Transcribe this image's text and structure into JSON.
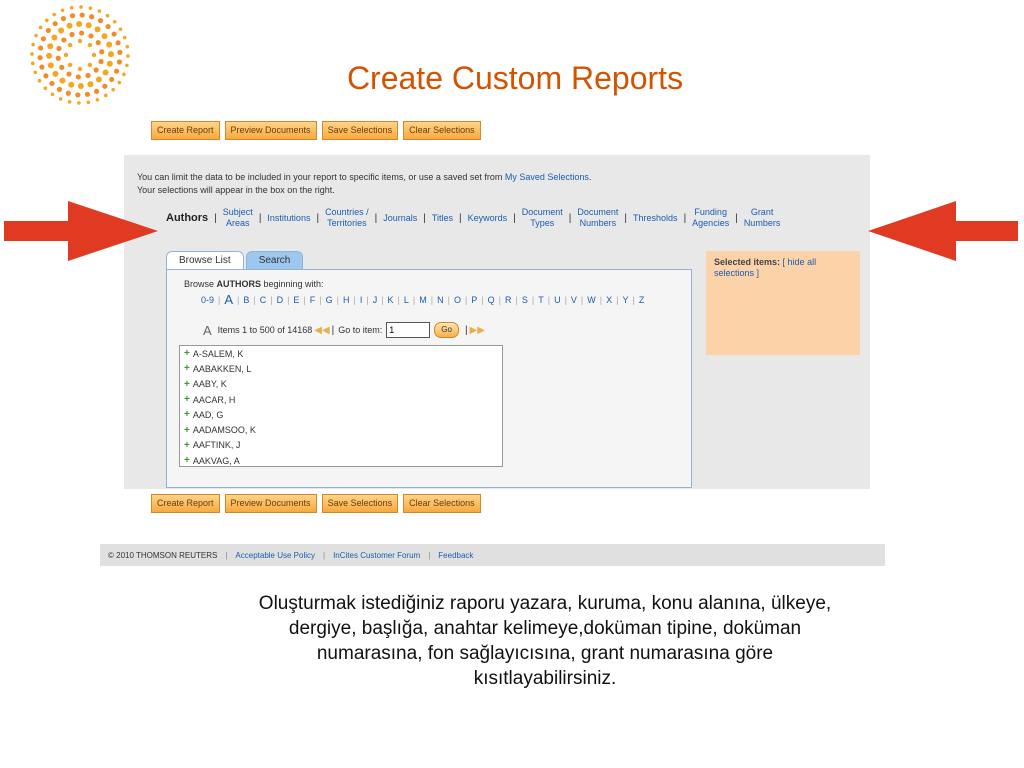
{
  "slide": {
    "title": "Create Custom Reports",
    "description": "Oluşturmak istediğiniz raporu yazara, kuruma, konu alanına, ülkeye, dergiye, başlığa, anahtar kelimeye,doküman tipine, doküman numarasına, fon sağlayıcısına, grant numarasına göre kısıtlayabilirsiniz."
  },
  "colors": {
    "accent": "#d35400",
    "button": "#f7a93f",
    "link": "#1a5db0",
    "selected_bg": "#fcd2a8",
    "arrow": "#e03a22"
  },
  "toolbar": {
    "create_report": "Create Report",
    "preview_documents": "Preview Documents",
    "save_selections": "Save Selections",
    "clear_selections": "Clear Selections"
  },
  "intro": {
    "line1_prefix": "You can limit the data to be included in your report to specific items, or use a saved set from ",
    "line1_link": "My Saved Selections",
    "line1_suffix": ".",
    "line2": "Your selections will appear in the box on the right."
  },
  "filters": {
    "authors": "Authors",
    "subject_areas": [
      "Subject",
      "Areas"
    ],
    "institutions": "Institutions",
    "countries": [
      "Countries /",
      "Territories"
    ],
    "journals": "Journals",
    "titles": "Titles",
    "keywords": "Keywords",
    "doc_types": [
      "Document",
      "Types"
    ],
    "doc_numbers": [
      "Document",
      "Numbers"
    ],
    "thresholds": "Thresholds",
    "funding": [
      "Funding",
      "Agencies"
    ],
    "grant": [
      "Grant",
      "Numbers"
    ]
  },
  "browse": {
    "tab_browse": "Browse List",
    "tab_search": "Search",
    "browse_prefix": "Browse ",
    "browse_bold": "AUTHORS",
    "browse_suffix": " beginning with:",
    "letters": [
      "0-9",
      "A",
      "B",
      "C",
      "D",
      "E",
      "F",
      "G",
      "H",
      "I",
      "J",
      "K",
      "L",
      "M",
      "N",
      "O",
      "P",
      "Q",
      "R",
      "S",
      "T",
      "U",
      "V",
      "W",
      "X",
      "Y",
      "Z"
    ],
    "current_letter": "A",
    "items_text": "Items 1 to 500 of 14168",
    "goto_label": "Go to item:",
    "goto_value": "1",
    "go_button": "Go",
    "authors": [
      "A-SALEM, K",
      "AABAKKEN, L",
      "AABY, K",
      "AACAR, H",
      "AAD, G",
      "AADAMSOO, K",
      "AAFTINK, J",
      "AAKVAG, A"
    ]
  },
  "selected": {
    "label": "Selected items:",
    "hide_link": "[ hide all selections ]"
  },
  "footer": {
    "copyright": "© 2010 THOMSON REUTERS",
    "policy": "Acceptable Use Policy",
    "forum": "InCites Customer Forum",
    "feedback": "Feedback"
  }
}
